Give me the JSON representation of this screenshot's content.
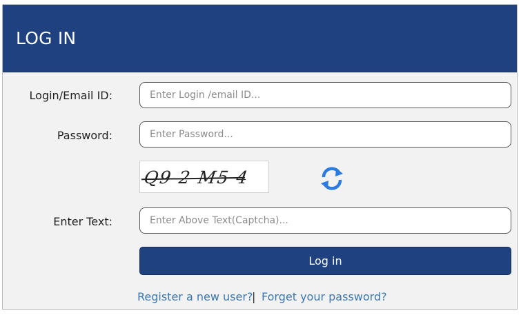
{
  "header": {
    "title": "LOG IN"
  },
  "form": {
    "login_label": "Login/Email ID:",
    "login_placeholder": "Enter Login /email ID...",
    "password_label": "Password:",
    "password_placeholder": "Enter Password...",
    "captcha_text": "Q9 2 M5 4",
    "captcha_label": "Enter Text:",
    "captcha_placeholder": "Enter Above Text(Captcha)...",
    "submit_label": "Log in"
  },
  "links": {
    "register": "Register a new user?",
    "separator": "|",
    "forgot": "Forget your password?"
  },
  "icons": {
    "refresh": "refresh-icon"
  },
  "colors": {
    "brand": "#1f4180",
    "link": "#3a78b5",
    "refresh": "#2b7be0"
  }
}
